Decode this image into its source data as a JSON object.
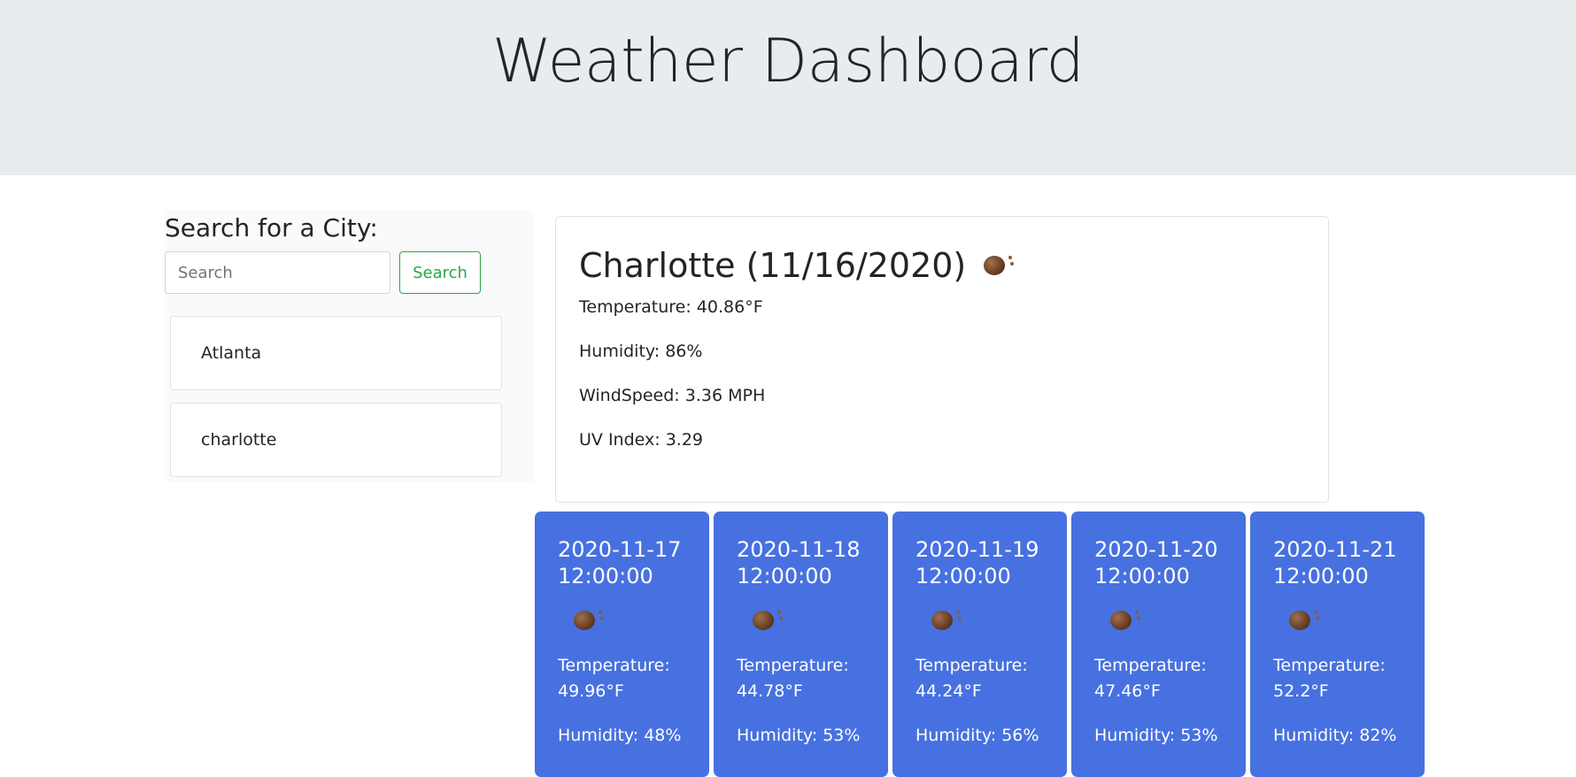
{
  "header": {
    "title": "Weather Dashboard"
  },
  "sidebar": {
    "heading": "Search for a City:",
    "search_placeholder": "Search",
    "search_button": "Search",
    "cities": [
      "Atlanta",
      "charlotte"
    ]
  },
  "current": {
    "title": "Charlotte (11/16/2020)",
    "icon": "weather-icon",
    "temperature": "Temperature: 40.86°F",
    "humidity": "Humidity: 86%",
    "wind": "WindSpeed: 3.36 MPH",
    "uv": "UV Index: 3.29"
  },
  "forecast": [
    {
      "date": "2020-11-17 12:00:00",
      "temp_label": "Temperature:",
      "temp": "49.96°F",
      "humidity": "Humidity: 48%"
    },
    {
      "date": "2020-11-18 12:00:00",
      "temp_label": "Temperature:",
      "temp": "44.78°F",
      "humidity": "Humidity: 53%"
    },
    {
      "date": "2020-11-19 12:00:00",
      "temp_label": "Temperature:",
      "temp": "44.24°F",
      "humidity": "Humidity: 56%"
    },
    {
      "date": "2020-11-20 12:00:00",
      "temp_label": "Temperature:",
      "temp": "47.46°F",
      "humidity": "Humidity: 53%"
    },
    {
      "date": "2020-11-21 12:00:00",
      "temp_label": "Temperature:",
      "temp": "52.2°F",
      "humidity": "Humidity: 82%"
    }
  ],
  "colors": {
    "header_bg": "#e9ecef",
    "forecast_bg": "#4771e0",
    "search_button": "#28a745"
  }
}
